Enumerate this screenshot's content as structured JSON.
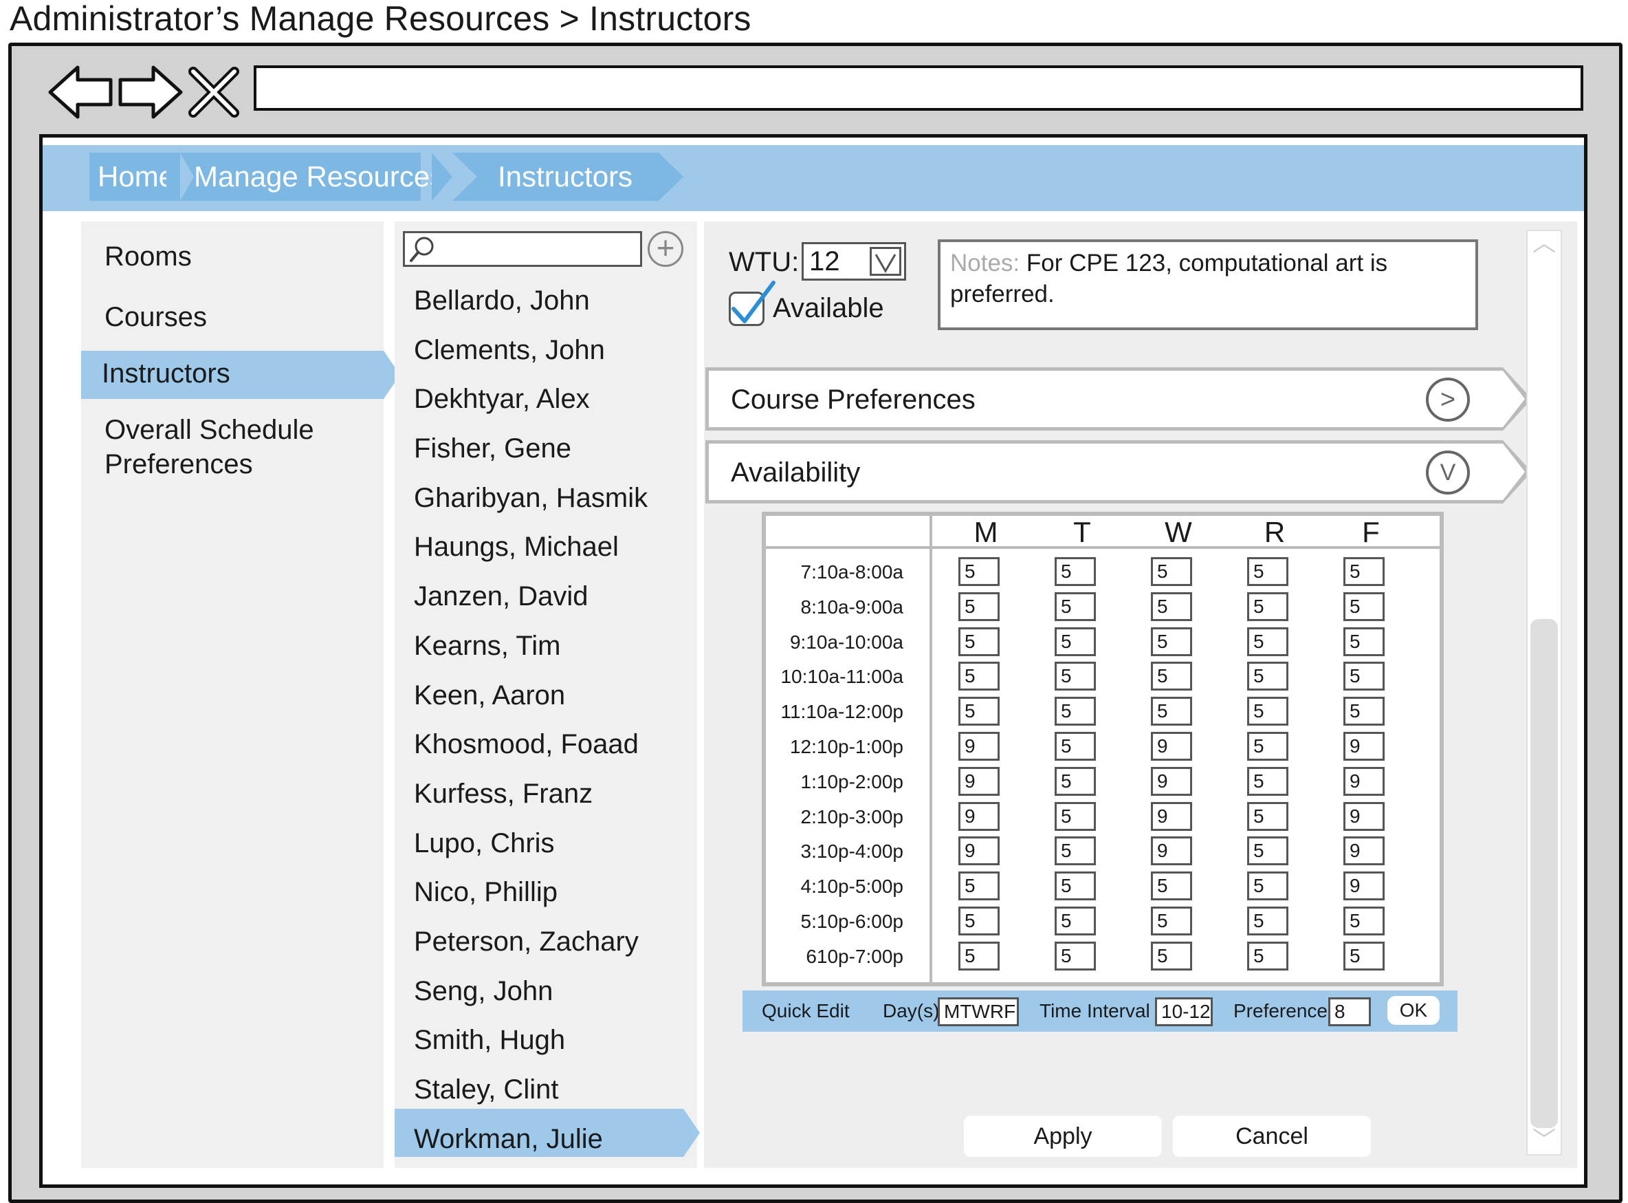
{
  "page_title": "Administrator’s Manage Resources > Instructors",
  "breadcrumb": [
    "Home",
    "Manage Resources",
    "Instructors"
  ],
  "sidebar": {
    "items": [
      {
        "label": "Rooms"
      },
      {
        "label": "Courses"
      },
      {
        "label": "Instructors",
        "active": true
      },
      {
        "label": "Overall Schedule\nPreferences",
        "lines": [
          "Overall Schedule",
          "Preferences"
        ]
      }
    ]
  },
  "search": {
    "placeholder": ""
  },
  "instructors": [
    "Bellardo, John",
    "Clements, John",
    "Dekhtyar, Alex",
    "Fisher, Gene",
    "Gharibyan, Hasmik",
    "Haungs, Michael",
    "Janzen, David",
    "Kearns, Tim",
    "Keen, Aaron",
    "Khosmood, Foaad",
    "Kurfess, Franz",
    "Lupo, Chris",
    "Nico, Phillip",
    "Peterson, Zachary",
    "Seng, John",
    "Smith, Hugh",
    "Staley, Clint",
    "Workman, Julie"
  ],
  "selected_instructor": "Workman, Julie",
  "detail": {
    "wtu_label": "WTU:",
    "wtu_value": "12",
    "available_label": "Available",
    "available_checked": true,
    "notes_label": "Notes:",
    "notes_text": "For CPE 123, computational art is preferred.",
    "course_prefs_label": "Course Preferences",
    "availability_label": "Availability"
  },
  "availability": {
    "days": [
      "M",
      "T",
      "W",
      "R",
      "F"
    ],
    "times": [
      "7:10a-8:00a",
      "8:10a-9:00a",
      "9:10a-10:00a",
      "10:10a-11:00a",
      "11:10a-12:00p",
      "12:10p-1:00p",
      "1:10p-2:00p",
      "2:10p-3:00p",
      "3:10p-4:00p",
      "4:10p-5:00p",
      "5:10p-6:00p",
      "610p-7:00p"
    ],
    "values": [
      [
        "5",
        "5",
        "5",
        "5",
        "5"
      ],
      [
        "5",
        "5",
        "5",
        "5",
        "5"
      ],
      [
        "5",
        "5",
        "5",
        "5",
        "5"
      ],
      [
        "5",
        "5",
        "5",
        "5",
        "5"
      ],
      [
        "5",
        "5",
        "5",
        "5",
        "5"
      ],
      [
        "9",
        "5",
        "9",
        "5",
        "9"
      ],
      [
        "9",
        "5",
        "9",
        "5",
        "9"
      ],
      [
        "9",
        "5",
        "9",
        "5",
        "9"
      ],
      [
        "9",
        "5",
        "9",
        "5",
        "9"
      ],
      [
        "5",
        "5",
        "5",
        "5",
        "9"
      ],
      [
        "5",
        "5",
        "5",
        "5",
        "5"
      ],
      [
        "5",
        "5",
        "5",
        "5",
        "5"
      ]
    ]
  },
  "quick_edit": {
    "label": "Quick Edit",
    "days_label": "Day(s)",
    "days_value": "MTWRF",
    "interval_label": "Time Interval",
    "interval_value": "10-12",
    "pref_label": "Preference",
    "pref_value": "8",
    "ok_label": "OK"
  },
  "buttons": {
    "apply": "Apply",
    "cancel": "Cancel"
  },
  "colors": {
    "accent": "#9ec9ea",
    "accent_dark": "#7db7e4",
    "check": "#2a8fd6"
  }
}
